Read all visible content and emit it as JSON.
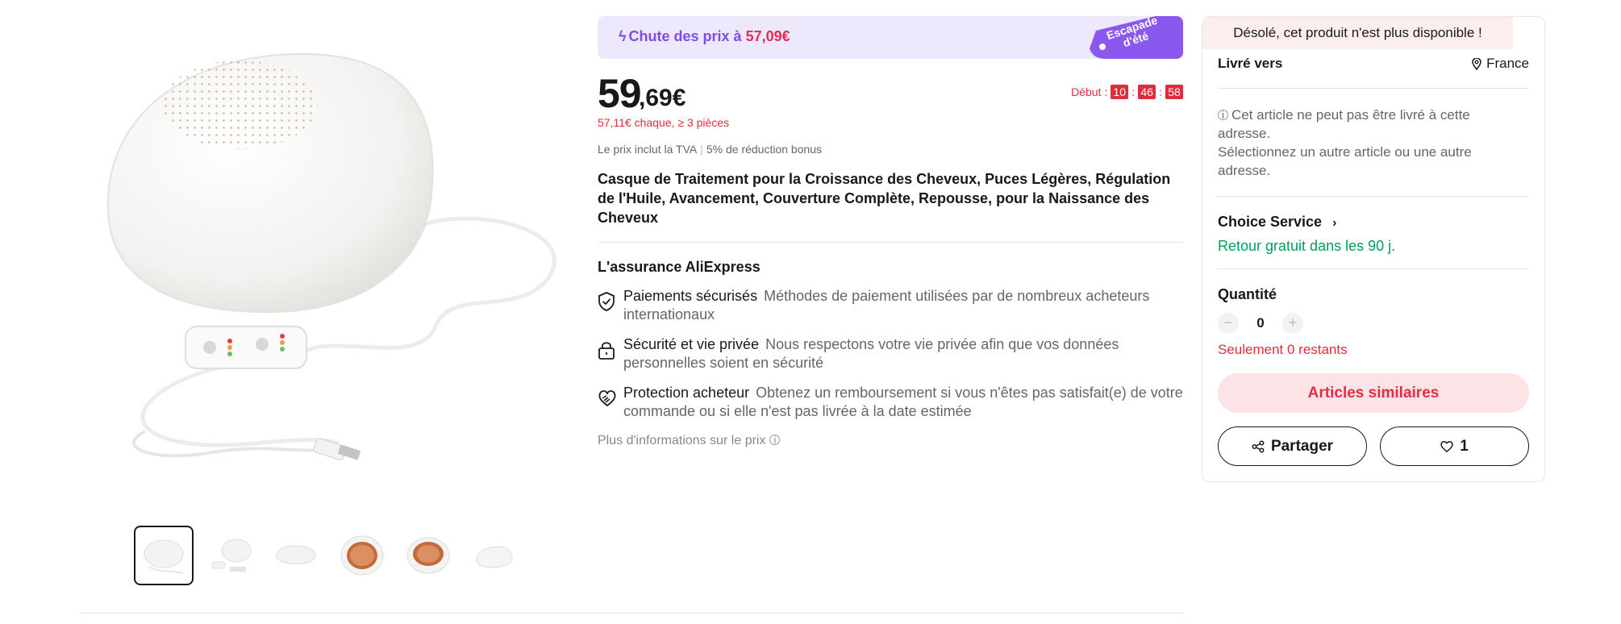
{
  "promo": {
    "bolt_icon": "lightning-icon",
    "label": "Chute des prix à ",
    "price": "57,09€",
    "tag": "Escapade d'été"
  },
  "price": {
    "integer": "59",
    "decimal": ",69€",
    "bulk": "57,11€ chaque, ≥ 3 pièces",
    "tax_note": "Le prix inclut la TVA",
    "tax_sep": "|",
    "bonus": "5% de réduction bonus"
  },
  "countdown": {
    "label": "Début :",
    "hours": "10",
    "minutes": "46",
    "seconds": "58",
    "sep": ":"
  },
  "product": {
    "title": "Casque de Traitement pour la Croissance des Cheveux, Puces Légères, Régulation de l'Huile, Avancement, Couverture Complète, Repousse, pour la Naissance des Cheveux"
  },
  "assurance": {
    "title": "L'assurance AliExpress",
    "items": [
      {
        "icon": "shield-check-icon",
        "label": "Paiements sécurisés",
        "text": "Méthodes de paiement utilisées par de nombreux acheteurs internationaux"
      },
      {
        "icon": "lock-icon",
        "label": "Sécurité et vie privée",
        "text": "Nous respectons votre vie privée afin que vos données personnelles soient en sécurité"
      },
      {
        "icon": "handshake-heart-icon",
        "label": "Protection acheteur",
        "text": "Obtenez un remboursement si vous n'êtes pas satisfait(e) de votre commande ou si elle n'est pas livrée à la date estimée"
      }
    ],
    "more_info": "Plus d'informations sur le prix"
  },
  "gallery": {
    "thumbnail_count": 6,
    "active_index": 0
  },
  "panel": {
    "unavailable": "Désolé, cet produit n'est plus disponible !",
    "ship_label": "Livré vers",
    "ship_country": "France",
    "ship_note_1": "Cet article ne peut pas être livré à cette adresse.",
    "ship_note_2": "Sélectionnez un autre article ou une autre adresse.",
    "choice_service": "Choice Service",
    "free_return": "Retour gratuit dans les 90 j.",
    "quantity_label": "Quantité",
    "quantity_value": "0",
    "minus": "−",
    "plus": "+",
    "remaining": "Seulement 0 restants",
    "similar_button": "Articles similaires",
    "share_button": "Partager",
    "wishlist_count": "1"
  },
  "colors": {
    "accent_red": "#e02d3c",
    "promo_purple": "#7e4ce9",
    "return_green": "#00a15a"
  }
}
